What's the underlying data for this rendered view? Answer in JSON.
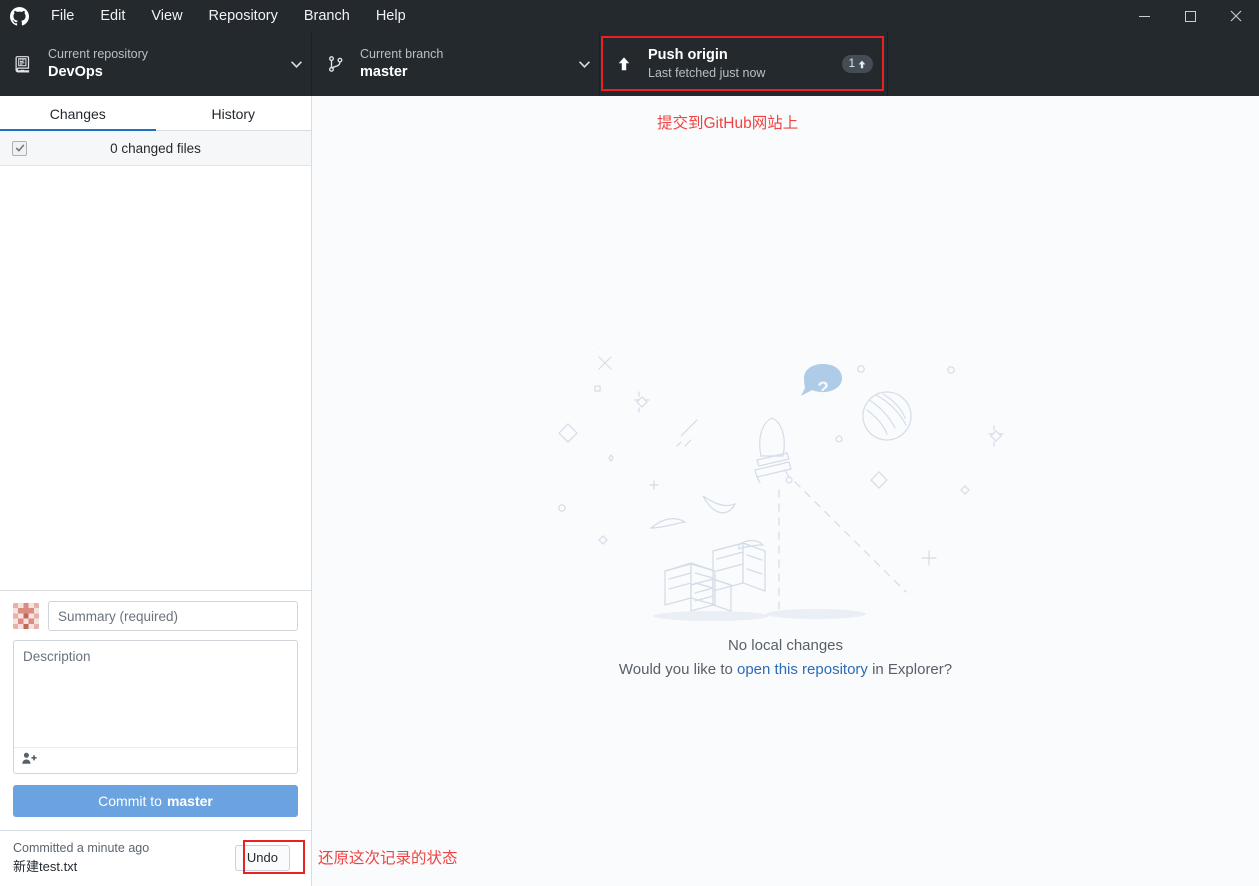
{
  "window": {
    "app_logo": "github-mark-icon",
    "controls": {
      "minimize": "minimize-icon",
      "maximize": "maximize-icon",
      "close": "close-icon"
    }
  },
  "menubar": {
    "items": [
      {
        "label": "File"
      },
      {
        "label": "Edit"
      },
      {
        "label": "View"
      },
      {
        "label": "Repository"
      },
      {
        "label": "Branch"
      },
      {
        "label": "Help"
      }
    ]
  },
  "toolbar": {
    "repository": {
      "label": "Current repository",
      "value": "DevOps",
      "icon": "repo-icon",
      "caret": "chevron-down-icon"
    },
    "branch": {
      "label": "Current branch",
      "value": "master",
      "icon": "branch-icon",
      "caret": "chevron-down-icon"
    },
    "push": {
      "label": "Push origin",
      "sublabel": "Last fetched just now",
      "icon": "arrow-up-icon",
      "badge_count": "1",
      "badge_icon": "arrow-up-small-icon"
    }
  },
  "sidebar": {
    "tabs": [
      {
        "label": "Changes",
        "active": true
      },
      {
        "label": "History",
        "active": false
      }
    ],
    "changed_files": {
      "label": "0 changed files",
      "checkbox": "checked"
    },
    "commit_form": {
      "avatar": "user-avatar-identicon",
      "summary_placeholder": "Summary (required)",
      "summary_value": "",
      "description_placeholder": "Description",
      "description_value": "",
      "coauthor_icon": "add-coauthor-icon",
      "commit_button_prefix": "Commit to",
      "commit_button_branch": "master"
    },
    "undo_bar": {
      "status": "Committed a minute ago",
      "commit_message": "新建test.txt",
      "undo_label": "Undo"
    }
  },
  "main": {
    "blank_slate": {
      "illustration": "space-rocket-no-changes-illustration",
      "title": "No local changes",
      "question_prefix": "Would you like to ",
      "question_link": "open this repository",
      "question_suffix": " in Explorer?"
    }
  },
  "annotations": [
    {
      "name": "push-origin-annotation",
      "text": "提交到GitHub网站上",
      "color": "#ef4343"
    },
    {
      "name": "undo-annotation",
      "text": "还原这次记录的状态",
      "color": "#ef4343"
    }
  ],
  "colors": {
    "titlebar": "#24292e",
    "toolbar": "#24292e",
    "accent_blue": "#1f6fc4",
    "commit_button": "#6ba3e0",
    "annotation_red": "#e62222",
    "main_bg": "#fafbfc"
  }
}
